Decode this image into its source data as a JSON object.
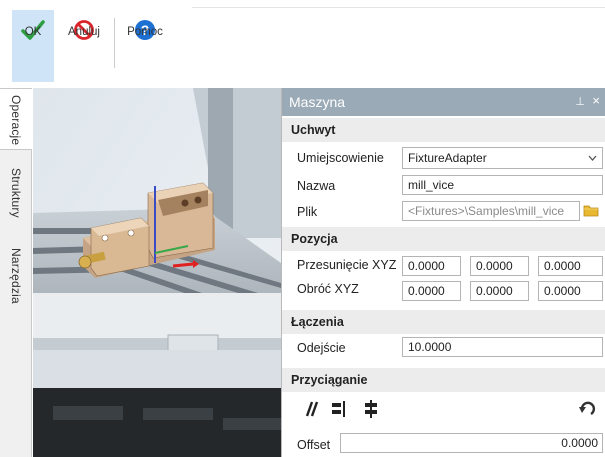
{
  "toolbar": {
    "ok_label": "OK",
    "cancel_label": "Anuluj",
    "help_label": "Pomoc",
    "help_glyph": "?",
    "colors": {
      "ok": "#2e9e44",
      "cancel": "#d9262b",
      "help": "#1d6fd1",
      "active_bg": "#cfe4f7"
    }
  },
  "side_tabs": [
    "Operacje",
    "Struktury",
    "Narzędzia"
  ],
  "panel": {
    "title": "Maszyna",
    "pin_glyph": "⊥",
    "close_glyph": "×",
    "fixture": {
      "header": "Uchwyt",
      "location_label": "Umiejscowienie",
      "location_value": "FixtureAdapter",
      "name_label": "Nazwa",
      "name_value": "mill_vice",
      "file_label": "Plik",
      "file_value": "<Fixtures>\\Samples\\mill_vice"
    },
    "position": {
      "header": "Pozycja",
      "offset_label": "Przesunięcie XYZ",
      "offset_values": [
        "0.0000",
        "0.0000",
        "0.0000"
      ],
      "rotate_label": "Obróć XYZ",
      "rotate_values": [
        "0.0000",
        "0.0000",
        "0.0000"
      ]
    },
    "connections": {
      "header": "Łączenia",
      "clearance_label": "Odejście",
      "clearance_value": "10.0000"
    },
    "snapping": {
      "header": "Przyciąganie",
      "offset_label": "Offset",
      "offset_value": "0.0000"
    }
  }
}
